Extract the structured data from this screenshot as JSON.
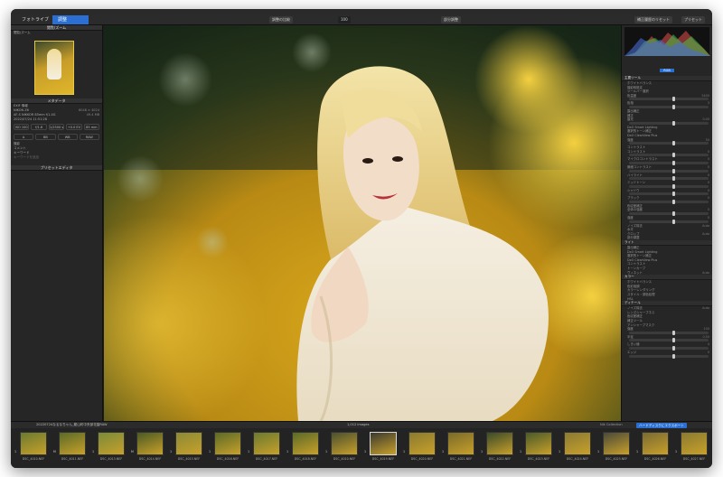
{
  "window": {
    "title": "DxO PhotoLab  —  20220724なるなちゃん_龍山町中央部花園RAW — DSC_4010.NEF"
  },
  "tabs": {
    "library": "フォトライブラリ",
    "customize": "調整"
  },
  "toolbar": {
    "compare": "調整の比較",
    "zoom": "100",
    "reset": "補正前比較",
    "history_label": "補正履歴のリセット",
    "preset_label": "プリセット",
    "compare_label": "部分調整"
  },
  "left": {
    "nav_title": "閲覧/ズーム",
    "nav_sub": "閲覧/ズーム",
    "meta_title": "メタデータ",
    "exif_header": "EXIF 情報",
    "exif_rows": [
      {
        "k": "NIKON Z6",
        "v": "6048 × 4024"
      },
      {
        "k": "AF-S NIKKOR 85mm f/1.4G",
        "v": "49.4 MB"
      },
      {
        "k": "2022/07/24 11:51:28",
        "v": ""
      }
    ],
    "exif_buttons": [
      "ISO 100",
      "f/1.6",
      "1/2500 s",
      "+0.0 EV",
      "85 mm"
    ],
    "icons_row": [
      "A",
      "BB",
      "WB",
      "RAW"
    ],
    "keywords_header": "キーワード",
    "keyword_placeholder": "キーワードを追加",
    "preset_editor": "プリセットエディタ",
    "other_rows": [
      {
        "k": "撮影",
        "v": ""
      },
      {
        "k": "コメント",
        "v": ""
      }
    ]
  },
  "right": {
    "mode": "RGB",
    "sections": [
      {
        "title": "主要ツール",
        "rows": [
          {
            "label": "ホワイトバランス",
            "value": ""
          },
          {
            "label": "撮影時設定",
            "value": ""
          },
          {
            "label": "ツールバー選択",
            "value": ""
          },
          {
            "label": "色温度",
            "value": "5400"
          },
          {
            "label": "色相",
            "value": "3"
          },
          {
            "label": "露出補正",
            "value": ""
          },
          {
            "label": "補正",
            "value": ""
          },
          {
            "label": "露光",
            "value": "0.00"
          },
          {
            "label": "DxO Smart Lighting",
            "value": ""
          },
          {
            "label": "選択的トーン補正",
            "value": ""
          },
          {
            "label": "DxO ClearView Plus",
            "value": ""
          },
          {
            "label": "強度",
            "value": "50"
          },
          {
            "label": "コントラスト",
            "value": ""
          },
          {
            "label": "コントラスト",
            "value": "0"
          },
          {
            "label": "マイクロコントラスト",
            "value": "0"
          },
          {
            "label": "微細コントラスト",
            "value": "0"
          },
          {
            "label": "ハイライト",
            "value": "0"
          },
          {
            "label": "ミッドトーン",
            "value": "0"
          },
          {
            "label": "シャドウ",
            "value": "0"
          },
          {
            "label": "ブラック",
            "value": "0"
          },
          {
            "label": "色収差補正",
            "value": ""
          },
          {
            "label": "全体の強度",
            "value": "0"
          },
          {
            "label": "強度",
            "value": "0"
          },
          {
            "label": "ノイズ除去",
            "value": "Auto"
          },
          {
            "label": "水平",
            "value": ""
          },
          {
            "label": "クロップ",
            "value": "Auto"
          },
          {
            "label": "部分調整",
            "value": ""
          }
        ]
      },
      {
        "title": "ライト",
        "rows": [
          {
            "label": "露出補正",
            "value": ""
          },
          {
            "label": "DxO Smart Lighting",
            "value": ""
          },
          {
            "label": "選択的トーン補正",
            "value": ""
          },
          {
            "label": "DxO ClearView Plus",
            "value": ""
          },
          {
            "label": "コントラスト",
            "value": ""
          },
          {
            "label": "トーンカーブ",
            "value": ""
          },
          {
            "label": "ヴィネット",
            "value": "Auto"
          }
        ]
      },
      {
        "title": "カラー",
        "rows": [
          {
            "label": "ホワイトバランス",
            "value": ""
          },
          {
            "label": "色彩強調",
            "value": ""
          },
          {
            "label": "カラーレンダリング",
            "value": ""
          },
          {
            "label": "スタイル・調色処理",
            "value": ""
          },
          {
            "label": "HSL",
            "value": ""
          }
        ]
      },
      {
        "title": "ディテール",
        "rows": [
          {
            "label": "ノイズ除去",
            "value": "Auto"
          },
          {
            "label": "レンズシャープネス",
            "value": ""
          },
          {
            "label": "色収差補正",
            "value": ""
          },
          {
            "label": "補正ツール",
            "value": ""
          },
          {
            "label": "アンシャープマスク",
            "value": ""
          },
          {
            "label": "強度",
            "value": "100"
          },
          {
            "label": "半径",
            "value": "0.50"
          },
          {
            "label": "しきい値",
            "value": "4"
          },
          {
            "label": "エッジ",
            "value": "0"
          }
        ]
      }
    ]
  },
  "bottom": {
    "path": "20220724なるなちゃん_龍山町中央部花園RAW",
    "count": "1,012 images",
    "nik": "Nik Collection",
    "export": "ハードディスクにエクスポート"
  },
  "filmstrip": [
    {
      "name": "DSC_4010.NEF",
      "badge": "1"
    },
    {
      "name": "DSC_4011.NEF",
      "badge": "M"
    },
    {
      "name": "DSC_4013.NEF",
      "badge": "1"
    },
    {
      "name": "DSC_4014.NEF",
      "badge": "M"
    },
    {
      "name": "DSC_4015.NEF",
      "badge": "1"
    },
    {
      "name": "DSC_4016.NEF",
      "badge": "1"
    },
    {
      "name": "DSC_4017.NEF",
      "badge": "1"
    },
    {
      "name": "DSC_4018.NEF",
      "badge": "1"
    },
    {
      "name": "DSC_4010.NEF",
      "badge": "1"
    },
    {
      "name": "DSC_4019.NEF",
      "badge": "1"
    },
    {
      "name": "DSC_4020.NEF",
      "badge": "1"
    },
    {
      "name": "DSC_4021.NEF",
      "badge": "1"
    },
    {
      "name": "DSC_4022.NEF",
      "badge": "1"
    },
    {
      "name": "DSC_4023.NEF",
      "badge": "1"
    },
    {
      "name": "DSC_4024.NEF",
      "badge": "1"
    },
    {
      "name": "DSC_4025.NEF",
      "badge": "1"
    },
    {
      "name": "DSC_4026.NEF",
      "badge": "1"
    },
    {
      "name": "DSC_4027.NEF",
      "badge": "1"
    }
  ]
}
